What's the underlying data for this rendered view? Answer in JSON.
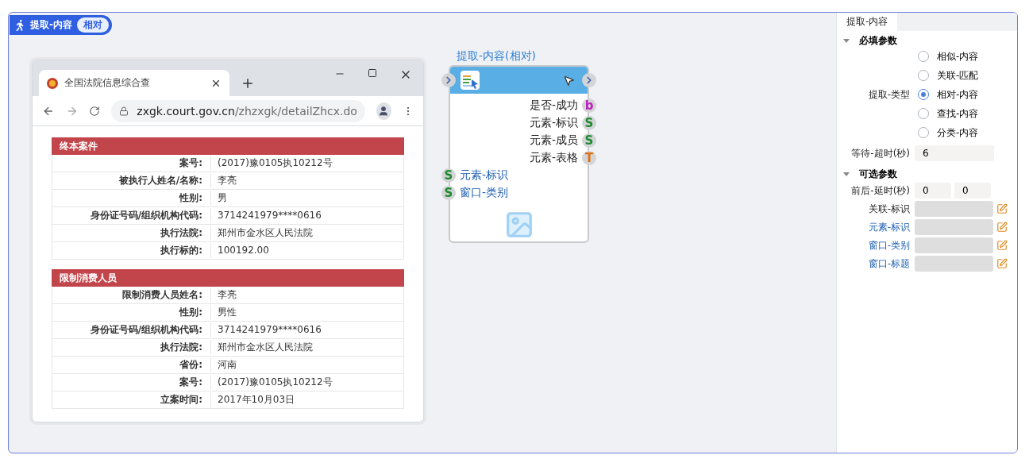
{
  "step_badge": {
    "title": "提取-内容",
    "tag": "相对"
  },
  "browser": {
    "tab_title": "全国法院信息综合查",
    "url_host": "zxgk.court.gov.cn",
    "url_path": "/zhzxgk/detailZhcx.do",
    "sections": [
      {
        "title": "终本案件",
        "rows": [
          {
            "label": "案号:",
            "value": "(2017)豫0105执10212号"
          },
          {
            "label": "被执行人姓名/名称:",
            "value": "李亮"
          },
          {
            "label": "性别:",
            "value": "男"
          },
          {
            "label": "身份证号码/组织机构代码:",
            "value": "3714241979****0616"
          },
          {
            "label": "执行法院:",
            "value": "郑州市金水区人民法院"
          },
          {
            "label": "执行标的:",
            "value": "100192.00"
          }
        ]
      },
      {
        "title": "限制消费人员",
        "rows": [
          {
            "label": "限制消费人员姓名:",
            "value": "李亮"
          },
          {
            "label": "性别:",
            "value": "男性"
          },
          {
            "label": "身份证号码/组织机构代码:",
            "value": "3714241979****0616"
          },
          {
            "label": "执行法院:",
            "value": "郑州市金水区人民法院"
          },
          {
            "label": "省份:",
            "value": "河南"
          },
          {
            "label": "案号:",
            "value": "(2017)豫0105执10212号"
          },
          {
            "label": "立案时间:",
            "value": "2017年10月03日"
          }
        ]
      }
    ]
  },
  "node": {
    "title": "提取-内容(相对)",
    "outputs": [
      {
        "label": "是否-成功",
        "type": "b",
        "color": "#c020c0"
      },
      {
        "label": "元素-标识",
        "type": "S",
        "color": "#208a30"
      },
      {
        "label": "元素-成员",
        "type": "S",
        "color": "#208a30"
      },
      {
        "label": "元素-表格",
        "type": "T",
        "color": "#e07010"
      }
    ],
    "inputs": [
      {
        "label": "元素-标识",
        "type": "S",
        "color": "#208a30"
      },
      {
        "label": "窗口-类别",
        "type": "S",
        "color": "#208a30"
      }
    ]
  },
  "panel": {
    "tab": "提取-内容",
    "required": {
      "title": "必填参数",
      "expanded": true,
      "type_field": {
        "label": "提取-类型",
        "options": [
          {
            "label": "相似-内容",
            "selected": false
          },
          {
            "label": "关联-匹配",
            "selected": false
          },
          {
            "label": "相对-内容",
            "selected": true
          },
          {
            "label": "查找-内容",
            "selected": false
          },
          {
            "label": "分类-内容",
            "selected": false
          }
        ]
      },
      "timeout": {
        "label": "等待-超时(秒)",
        "value": "6"
      }
    },
    "optional": {
      "title": "可选参数",
      "expanded": true,
      "delay": {
        "label": "前后-延时(秒)",
        "values": [
          "0",
          "0"
        ]
      },
      "fields": [
        {
          "label": "关联-标识",
          "kind": "plain"
        },
        {
          "label": "元素-标识",
          "kind": "linked"
        },
        {
          "label": "窗口-类别",
          "kind": "linked"
        },
        {
          "label": "窗口-标题",
          "kind": "linked"
        }
      ]
    }
  }
}
